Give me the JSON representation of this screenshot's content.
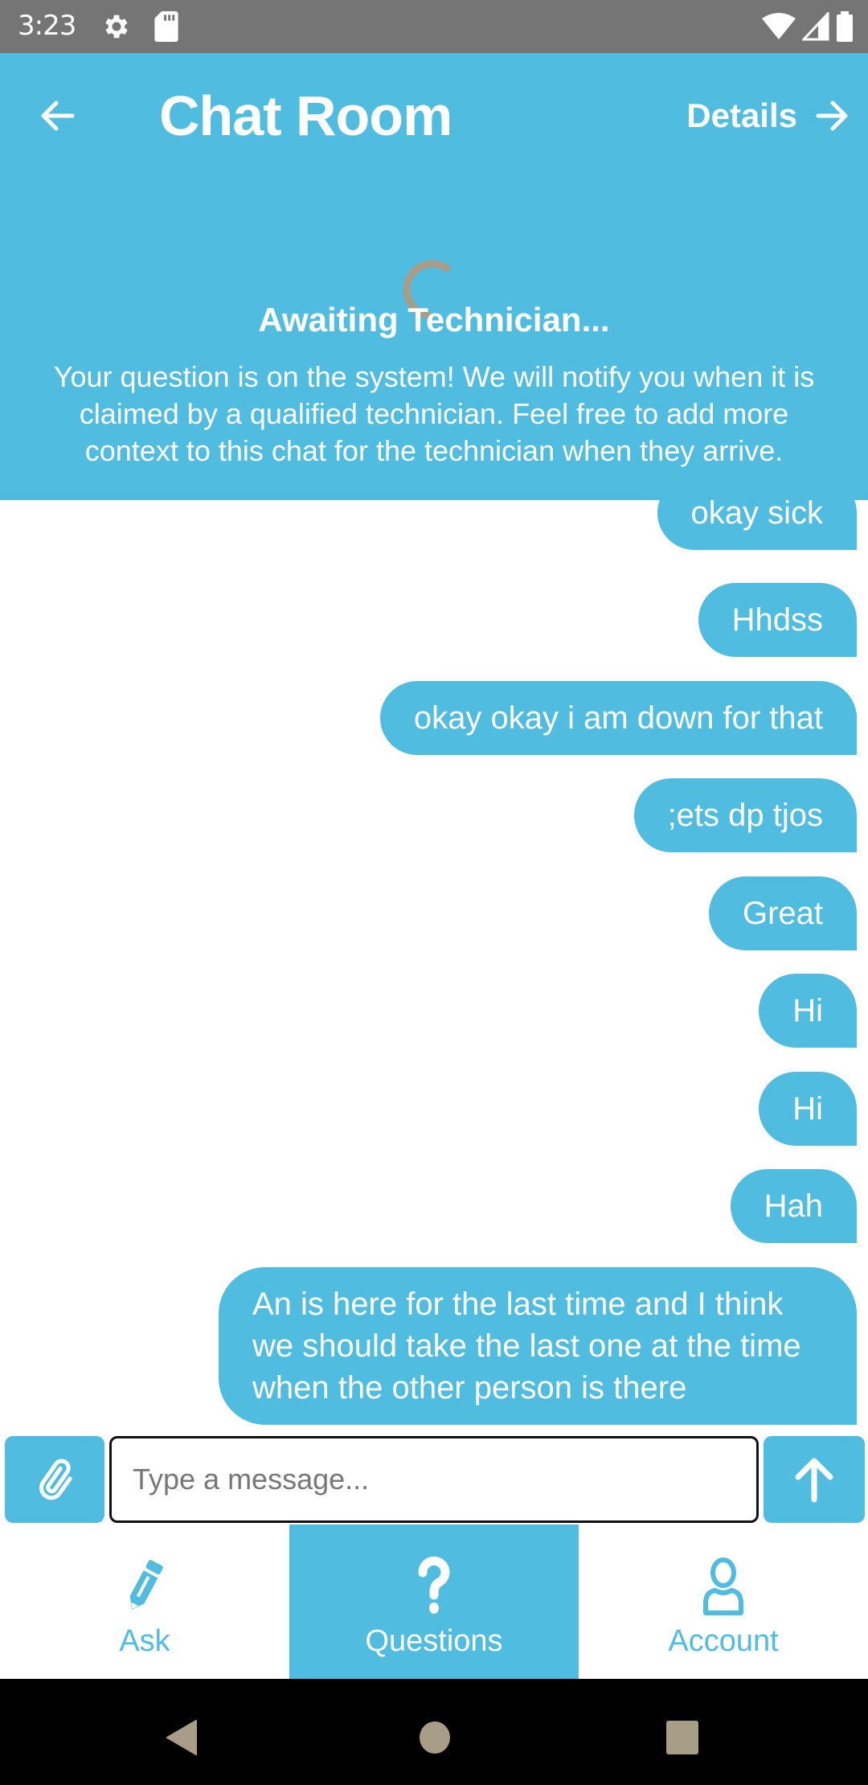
{
  "status_bar": {
    "time": "3:23",
    "left_icons": [
      "gear-icon",
      "sd-card-icon"
    ],
    "right_icons": [
      "wifi-icon",
      "cell-signal-icon",
      "battery-icon"
    ]
  },
  "header": {
    "title": "Chat Room",
    "back_icon": "arrow-left-icon",
    "details_label": "Details",
    "details_icon": "arrow-right-icon",
    "status_title": "Awaiting Technician...",
    "status_description": "Your question is on the system! We will notify you when it is claimed by a qualified technician. Feel free to add more context to this chat for the technician when they arrive.",
    "spinner_color": "#a89e88"
  },
  "messages": [
    {
      "text": "okay sick",
      "sender": "me"
    },
    {
      "text": "Hhdss",
      "sender": "me"
    },
    {
      "text": "okay okay i am down for that",
      "sender": "me"
    },
    {
      "text": ";ets dp tjos",
      "sender": "me"
    },
    {
      "text": "Great",
      "sender": "me"
    },
    {
      "text": "Hi",
      "sender": "me"
    },
    {
      "text": "Hi",
      "sender": "me"
    },
    {
      "text": "Hah",
      "sender": "me"
    },
    {
      "text": "An is here for the last time and I think we should take the last one at the time when the other person is there",
      "sender": "me"
    }
  ],
  "composer": {
    "attach_icon": "paperclip-icon",
    "placeholder": "Type a message...",
    "value": "",
    "send_icon": "arrow-up-icon"
  },
  "bottom_nav": {
    "items": [
      {
        "label": "Ask",
        "icon": "pencil-icon",
        "active": false
      },
      {
        "label": "Questions",
        "icon": "question-mark-icon",
        "active": true
      },
      {
        "label": "Account",
        "icon": "user-icon",
        "active": false
      }
    ]
  },
  "system_nav": {
    "buttons": [
      "back-triangle-icon",
      "home-circle-icon",
      "recents-square-icon"
    ]
  },
  "colors": {
    "accent": "#50bde0",
    "status_bar": "#757575",
    "system_nav": "#000000",
    "system_nav_icons": "#a89e88"
  }
}
